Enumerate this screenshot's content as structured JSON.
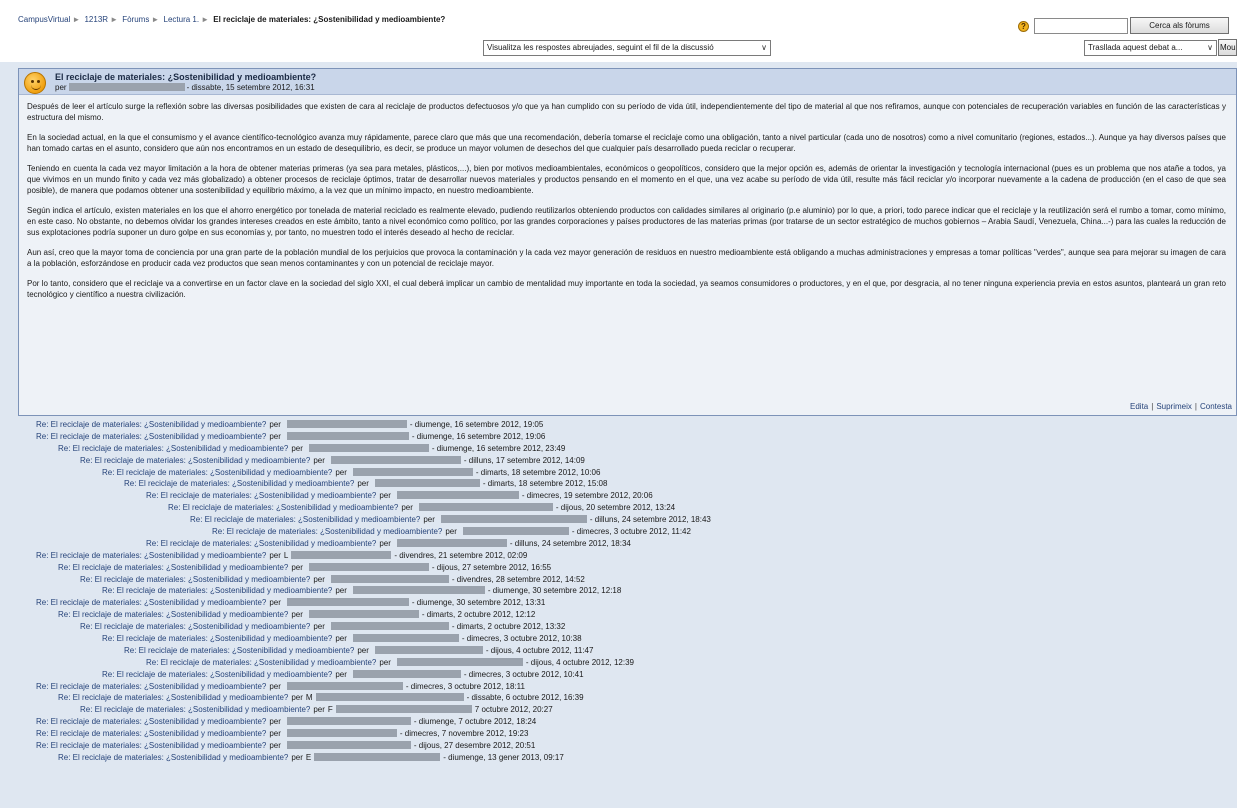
{
  "breadcrumb": {
    "items": [
      "CampusVirtual",
      "1213R",
      "Fòrums",
      "Lectura 1."
    ],
    "separator": "►",
    "current": "El reciclaje de materiales: ¿Sostenibilidad y medioambiente?"
  },
  "toolbar": {
    "help_icon": "?",
    "search_placeholder": "",
    "search_button": "Cerca als fòrums",
    "display_mode": "Visualitza les respostes abreujades, seguint el fil de la discussió",
    "move_label": "Trasllada aquest debat a...",
    "move_button": "Mou",
    "chevron": "∨"
  },
  "post": {
    "subject": "El reciclaje de materiales: ¿Sostenibilidad y medioambiente?",
    "byline_prefix": "per",
    "byline_date": "- dissabte, 15 setembre 2012, 16:31",
    "paragraphs": [
      "Después de leer el artículo surge la reflexión sobre las diversas posibilidades que existen de cara al reciclaje de productos defectuosos y/o que ya han cumplido con su período de vida útil, independientemente del tipo de material al que nos refiramos, aunque con potenciales de recuperación variables en función de las características y estructura del mismo.",
      "En la sociedad actual, en la que el consumismo y el avance científico-tecnológico avanza muy rápidamente, parece claro que más que una recomendación, debería tomarse el reciclaje como una obligación, tanto a nivel particular (cada uno de nosotros) como a nivel comunitario (regiones, estados...). Aunque ya hay diversos países que han tomado cartas en el asunto, considero que aún nos encontramos en un estado de desequilibrio, es decir, se produce un mayor volumen de desechos del que cualquier país desarrollado pueda reciclar o recuperar.",
      "Teniendo en cuenta la cada vez mayor limitación a la hora de obtener materias primeras (ya sea para metales, plásticos,...), bien por motivos medioambientales, económicos o geopolíticos, considero que la mejor opción es, además de orientar la investigación y tecnología internacional (pues es un problema que nos atañe a todos, ya que vivimos en un mundo finito y cada vez más globalizado) a obtener procesos de reciclaje óptimos, tratar de desarrollar nuevos materiales y productos pensando en el momento en el que, una vez acabe su período de vida útil, resulte más fácil reciclar y/o incorporar nuevamente a la cadena de producción (en el caso de que sea posible), de manera que podamos obtener una sostenibilidad y equilibrio máximo, a la vez que un mínimo impacto, en nuestro medioambiente.",
      "Según indica el artículo, existen materiales en los que el ahorro energético por tonelada de material reciclado es realmente elevado, pudiendo reutilizarlos obteniendo productos con calidades similares al originario (p.e aluminio) por lo que, a priori, todo parece indicar que el reciclaje y la reutilización será el rumbo a tomar, como mínimo, en este caso. No obstante, no debemos olvidar los grandes intereses creados en este ámbito, tanto a nivel económico como político, por las grandes corporaciones y países productores de las materias primas (por tratarse de un sector estratégico de muchos gobiernos – Arabia Saudí, Venezuela, China...-) para las cuales la reducción de sus explotaciones podría suponer un duro golpe en sus economías y, por tanto, no muestren todo el interés deseado al hecho de reciclar.",
      "Aun así, creo que la mayor toma de conciencia por una gran parte de la población mundial de los perjuicios que provoca la contaminación y la cada vez mayor generación de residuos en nuestro medioambiente está obligando a muchas administraciones y empresas a tomar políticas \"verdes\", aunque sea para mejorar su imagen de cara a la población, esforzándose en producir cada vez productos que sean menos contaminantes y con un potencial de reciclaje mayor.",
      "Por lo tanto, considero que el reciclaje va a convertirse en un factor clave en la sociedad del siglo XXI, el cual deberá implicar un cambio de mentalidad muy importante en toda la sociedad, ya seamos consumidores o productores, y en el que, por desgracia, al no tener ninguna experiencia previa en estos asuntos, planteará un gran reto tecnológico y científico a nuestra civilización."
    ],
    "commands": [
      "Edita",
      "Suprimeix",
      "Contesta"
    ]
  },
  "replies": [
    {
      "subject": "Re: El reciclaje de materiales: ¿Sostenibilidad y medioambiente?",
      "per": "per",
      "initial": "",
      "date": "- diumenge, 16 setembre 2012, 19:05",
      "level": 0
    },
    {
      "subject": "Re: El reciclaje de materiales: ¿Sostenibilidad y medioambiente?",
      "per": "per",
      "initial": "",
      "date": "- diumenge, 16 setembre 2012, 19:06",
      "level": 0
    },
    {
      "subject": "Re: El reciclaje de materiales: ¿Sostenibilidad y medioambiente?",
      "per": "per",
      "initial": "",
      "date": "- diumenge, 16 setembre 2012, 23:49",
      "level": 1
    },
    {
      "subject": "Re: El reciclaje de materiales: ¿Sostenibilidad y medioambiente?",
      "per": "per",
      "initial": "",
      "date": "- dilluns, 17 setembre 2012, 14:09",
      "level": 2
    },
    {
      "subject": "Re: El reciclaje de materiales: ¿Sostenibilidad y medioambiente?",
      "per": "per",
      "initial": "",
      "date": "- dimarts, 18 setembre 2012, 10:06",
      "level": 3
    },
    {
      "subject": "Re: El reciclaje de materiales: ¿Sostenibilidad y medioambiente?",
      "per": "per",
      "initial": "",
      "date": "- dimarts, 18 setembre 2012, 15:08",
      "level": 4
    },
    {
      "subject": "Re: El reciclaje de materiales: ¿Sostenibilidad y medioambiente?",
      "per": "per",
      "initial": "",
      "date": "- dimecres, 19 setembre 2012, 20:06",
      "level": 5
    },
    {
      "subject": "Re: El reciclaje de materiales: ¿Sostenibilidad y medioambiente?",
      "per": "per",
      "initial": "",
      "date": "- dijous, 20 setembre 2012, 13:24",
      "level": 6
    },
    {
      "subject": "Re: El reciclaje de materiales: ¿Sostenibilidad y medioambiente?",
      "per": "per",
      "initial": "",
      "date": "- dilluns, 24 setembre 2012, 18:43",
      "level": 7
    },
    {
      "subject": "Re: El reciclaje de materiales: ¿Sostenibilidad y medioambiente?",
      "per": "per",
      "initial": "",
      "date": "- dimecres, 3 octubre 2012, 11:42",
      "level": 8
    },
    {
      "subject": "Re: El reciclaje de materiales: ¿Sostenibilidad y medioambiente?",
      "per": "per",
      "initial": "",
      "date": "- dilluns, 24 setembre 2012, 18:34",
      "level": 5
    },
    {
      "subject": "Re: El reciclaje de materiales: ¿Sostenibilidad y medioambiente?",
      "per": "per",
      "initial": "L",
      "date": "- divendres, 21 setembre 2012, 02:09",
      "level": 0
    },
    {
      "subject": "Re: El reciclaje de materiales: ¿Sostenibilidad y medioambiente?",
      "per": "per",
      "initial": "",
      "date": "- dijous, 27 setembre 2012, 16:55",
      "level": 1
    },
    {
      "subject": "Re: El reciclaje de materiales: ¿Sostenibilidad y medioambiente?",
      "per": "per",
      "initial": "",
      "date": "- divendres, 28 setembre 2012, 14:52",
      "level": 2
    },
    {
      "subject": "Re: El reciclaje de materiales: ¿Sostenibilidad y medioambiente?",
      "per": "per",
      "initial": "",
      "date": "- diumenge, 30 setembre 2012, 12:18",
      "level": 3
    },
    {
      "subject": "Re: El reciclaje de materiales: ¿Sostenibilidad y medioambiente?",
      "per": "per",
      "initial": "",
      "date": "- diumenge, 30 setembre 2012, 13:31",
      "level": 0
    },
    {
      "subject": "Re: El reciclaje de materiales: ¿Sostenibilidad y medioambiente?",
      "per": "per",
      "initial": "",
      "date": "- dimarts, 2 octubre 2012, 12:12",
      "level": 1
    },
    {
      "subject": "Re: El reciclaje de materiales: ¿Sostenibilidad y medioambiente?",
      "per": "per",
      "initial": "",
      "date": "- dimarts, 2 octubre 2012, 13:32",
      "level": 2
    },
    {
      "subject": "Re: El reciclaje de materiales: ¿Sostenibilidad y medioambiente?",
      "per": "per",
      "initial": "",
      "date": "- dimecres, 3 octubre 2012, 10:38",
      "level": 3
    },
    {
      "subject": "Re: El reciclaje de materiales: ¿Sostenibilidad y medioambiente?",
      "per": "per",
      "initial": "",
      "date": "- dijous, 4 octubre 2012, 11:47",
      "level": 4
    },
    {
      "subject": "Re: El reciclaje de materiales: ¿Sostenibilidad y medioambiente?",
      "per": "per",
      "initial": "",
      "date": "- dijous, 4 octubre 2012, 12:39",
      "level": 5
    },
    {
      "subject": "Re: El reciclaje de materiales: ¿Sostenibilidad y medioambiente?",
      "per": "per",
      "initial": "",
      "date": "- dimecres, 3 octubre 2012, 10:41",
      "level": 3
    },
    {
      "subject": "Re: El reciclaje de materiales: ¿Sostenibilidad y medioambiente?",
      "per": "per",
      "initial": "",
      "date": "- dimecres, 3 octubre 2012, 18:11",
      "level": 0
    },
    {
      "subject": "Re: El reciclaje de materiales: ¿Sostenibilidad y medioambiente?",
      "per": "per",
      "initial": "M",
      "date": "- dissabte, 6 octubre 2012, 16:39",
      "level": 1
    },
    {
      "subject": "Re: El reciclaje de materiales: ¿Sostenibilidad y medioambiente?",
      "per": "per",
      "initial": "F",
      "date": "7 octubre 2012, 20:27",
      "level": 2
    },
    {
      "subject": "Re: El reciclaje de materiales: ¿Sostenibilidad y medioambiente?",
      "per": "per",
      "initial": "",
      "date": "- diumenge, 7 octubre 2012, 18:24",
      "level": 0
    },
    {
      "subject": "Re: El reciclaje de materiales: ¿Sostenibilidad y medioambiente?",
      "per": "per",
      "initial": "",
      "date": "- dimecres, 7 novembre 2012, 19:23",
      "level": 0
    },
    {
      "subject": "Re: El reciclaje de materiales: ¿Sostenibilidad y medioambiente?",
      "per": "per",
      "initial": "",
      "date": "- dijous, 27 desembre 2012, 20:51",
      "level": 0
    },
    {
      "subject": "Re: El reciclaje de materiales: ¿Sostenibilidad y medioambiente?",
      "per": "per",
      "initial": "E",
      "date": "- diumenge, 13 gener 2013, 09:17",
      "level": 1
    }
  ]
}
